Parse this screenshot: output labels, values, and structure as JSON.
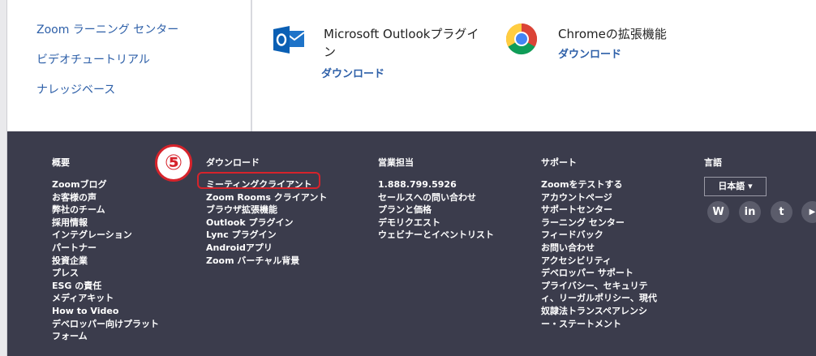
{
  "sidebar": {
    "links": [
      "Zoom ラーニング センター",
      "ビデオチュートリアル",
      "ナレッジベース"
    ]
  },
  "plugins": {
    "outlook": {
      "title_line1": "Microsoft Outlookプラグイ",
      "title_line2": "ン",
      "link": "ダウンロード"
    },
    "chrome": {
      "title": "Chromeの拡張機能",
      "link": "ダウンロード"
    }
  },
  "annotation": {
    "badge": "⑤"
  },
  "footer": {
    "columns": [
      {
        "heading": "概要",
        "items": [
          "Zoomブログ",
          "お客様の声",
          "弊社のチーム",
          "採用情報",
          "インテグレーション",
          "パートナー",
          "投資企業",
          "プレス",
          "ESG の責任",
          "メディアキット",
          "How to Video",
          "デベロッパー向けプラット",
          "フォーム"
        ]
      },
      {
        "heading": "ダウンロード",
        "items": [
          "ミーティングクライアント",
          "Zoom Rooms クライアント",
          "ブラウザ拡張機能",
          "Outlook プラグイン",
          "Lync プラグイン",
          "Androidアプリ",
          "Zoom バーチャル背景"
        ]
      },
      {
        "heading": "営業担当",
        "items": [
          "1.888.799.5926",
          "セールスへの問い合わせ",
          "プランと価格",
          "デモリクエスト",
          "ウェビナーとイベントリスト"
        ]
      },
      {
        "heading": "サポート",
        "items": [
          "Zoomをテストする",
          "アカウントページ",
          "サポートセンター",
          "ラーニング センター",
          "フィードバック",
          "お問い合わせ",
          "アクセシビリティ",
          "デベロッパー サポート",
          "プライバシー、セキュリテ",
          "ィ、リーガルポリシー、現代",
          "奴隷法トランスペアレンシ",
          "ー・ステートメント"
        ]
      }
    ],
    "language": {
      "heading": "言語",
      "selected": "日本語 ▾"
    },
    "social": [
      "W",
      "in",
      "t",
      "▶"
    ]
  },
  "colors": {
    "footer_bg": "#3b3c4c",
    "link_blue": "#2d5fa8",
    "highlight_red": "#d6232b"
  }
}
